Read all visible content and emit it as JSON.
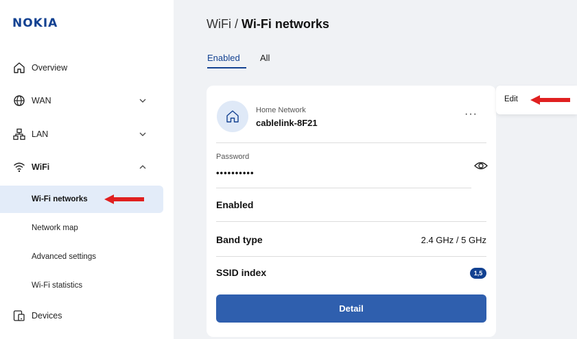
{
  "brand": {
    "logo_text": "NOKIA",
    "color": "#124191"
  },
  "sidebar": {
    "items": [
      {
        "label": "Overview",
        "icon": "home-icon",
        "expandable": false
      },
      {
        "label": "WAN",
        "icon": "globe-icon",
        "expandable": true,
        "expanded": false
      },
      {
        "label": "LAN",
        "icon": "network-icon",
        "expandable": true,
        "expanded": false
      },
      {
        "label": "WiFi",
        "icon": "wifi-icon",
        "expandable": true,
        "expanded": true
      },
      {
        "label": "Devices",
        "icon": "devices-icon",
        "expandable": false
      }
    ],
    "wifi_subitems": [
      {
        "label": "Wi-Fi networks",
        "active": true
      },
      {
        "label": "Network map",
        "active": false
      },
      {
        "label": "Advanced settings",
        "active": false
      },
      {
        "label": "Wi-Fi statistics",
        "active": false
      }
    ]
  },
  "breadcrumb": {
    "parent": "WiFi",
    "separator": "/",
    "current": "Wi-Fi networks"
  },
  "tabs": [
    {
      "label": "Enabled",
      "active": true
    },
    {
      "label": "All",
      "active": false
    }
  ],
  "network_card": {
    "network_label": "Home Network",
    "network_name": "cablelink-8F21",
    "more_label": "···",
    "password_label": "Password",
    "password_value": "••••••••••",
    "status_label": "Enabled",
    "band_type_label": "Band type",
    "band_type_value": "2.4 GHz / 5 GHz",
    "ssid_index_label": "SSID index",
    "ssid_index_value": "1,5",
    "detail_button": "Detail"
  },
  "context_menu": {
    "edit_label": "Edit"
  },
  "colors": {
    "accent": "#124191",
    "button": "#2f5fae",
    "annotation_arrow": "#e02020",
    "active_bg": "#e3ecf9"
  }
}
